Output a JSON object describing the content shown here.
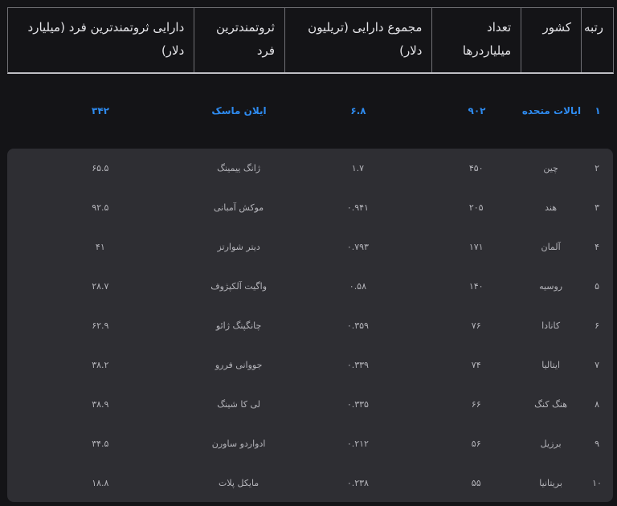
{
  "headers": {
    "rank": "رتبه",
    "country": "کشور",
    "count": "تعداد میلیاردرها",
    "total": "مجموع دارایی (تریلیون دلار)",
    "person": "ثروتمندترین فرد",
    "wealth": "دارایی ثروتمندترین فرد (میلیارد دلار)"
  },
  "first_row": {
    "rank": "۱",
    "country": "ایالات متحده",
    "count": "۹۰۲",
    "total": "۶.۸",
    "person": "ایلان ماسک",
    "wealth": "۳۴۲"
  },
  "rows": [
    {
      "rank": "۲",
      "country": "چین",
      "count": "۴۵۰",
      "total": "۱.۷",
      "person": "ژانگ ییمینگ",
      "wealth": "۶۵.۵"
    },
    {
      "rank": "۳",
      "country": "هند",
      "count": "۲۰۵",
      "total": "۰.۹۴۱",
      "person": "موکش آمبانی",
      "wealth": "۹۲.۵"
    },
    {
      "rank": "۴",
      "country": "آلمان",
      "count": "۱۷۱",
      "total": "۰.۷۹۳",
      "person": "دیتر شوارتز",
      "wealth": "۴۱"
    },
    {
      "rank": "۵",
      "country": "روسیه",
      "count": "۱۴۰",
      "total": "۰.۵۸",
      "person": "واگیت آلکپژوف",
      "wealth": "۲۸.۷"
    },
    {
      "rank": "۶",
      "country": "کانادا",
      "count": "۷۶",
      "total": "۰.۳۵۹",
      "person": "چانگپنگ ژائو",
      "wealth": "۶۲.۹"
    },
    {
      "rank": "۷",
      "country": "ایتالیا",
      "count": "۷۴",
      "total": "۰.۳۳۹",
      "person": "جووانی فررو",
      "wealth": "۳۸.۲"
    },
    {
      "rank": "۸",
      "country": "هنگ کنگ",
      "count": "۶۶",
      "total": "۰.۳۳۵",
      "person": "لی کا شینگ",
      "wealth": "۳۸.۹"
    },
    {
      "rank": "۹",
      "country": "برزیل",
      "count": "۵۶",
      "total": "۰.۲۱۲",
      "person": "ادواردو ساورن",
      "wealth": "۳۴.۵"
    },
    {
      "rank": "۱۰",
      "country": "بریتانیا",
      "count": "۵۵",
      "total": "۰.۲۳۸",
      "person": "مایکل پلات",
      "wealth": "۱۸.۸"
    }
  ]
}
